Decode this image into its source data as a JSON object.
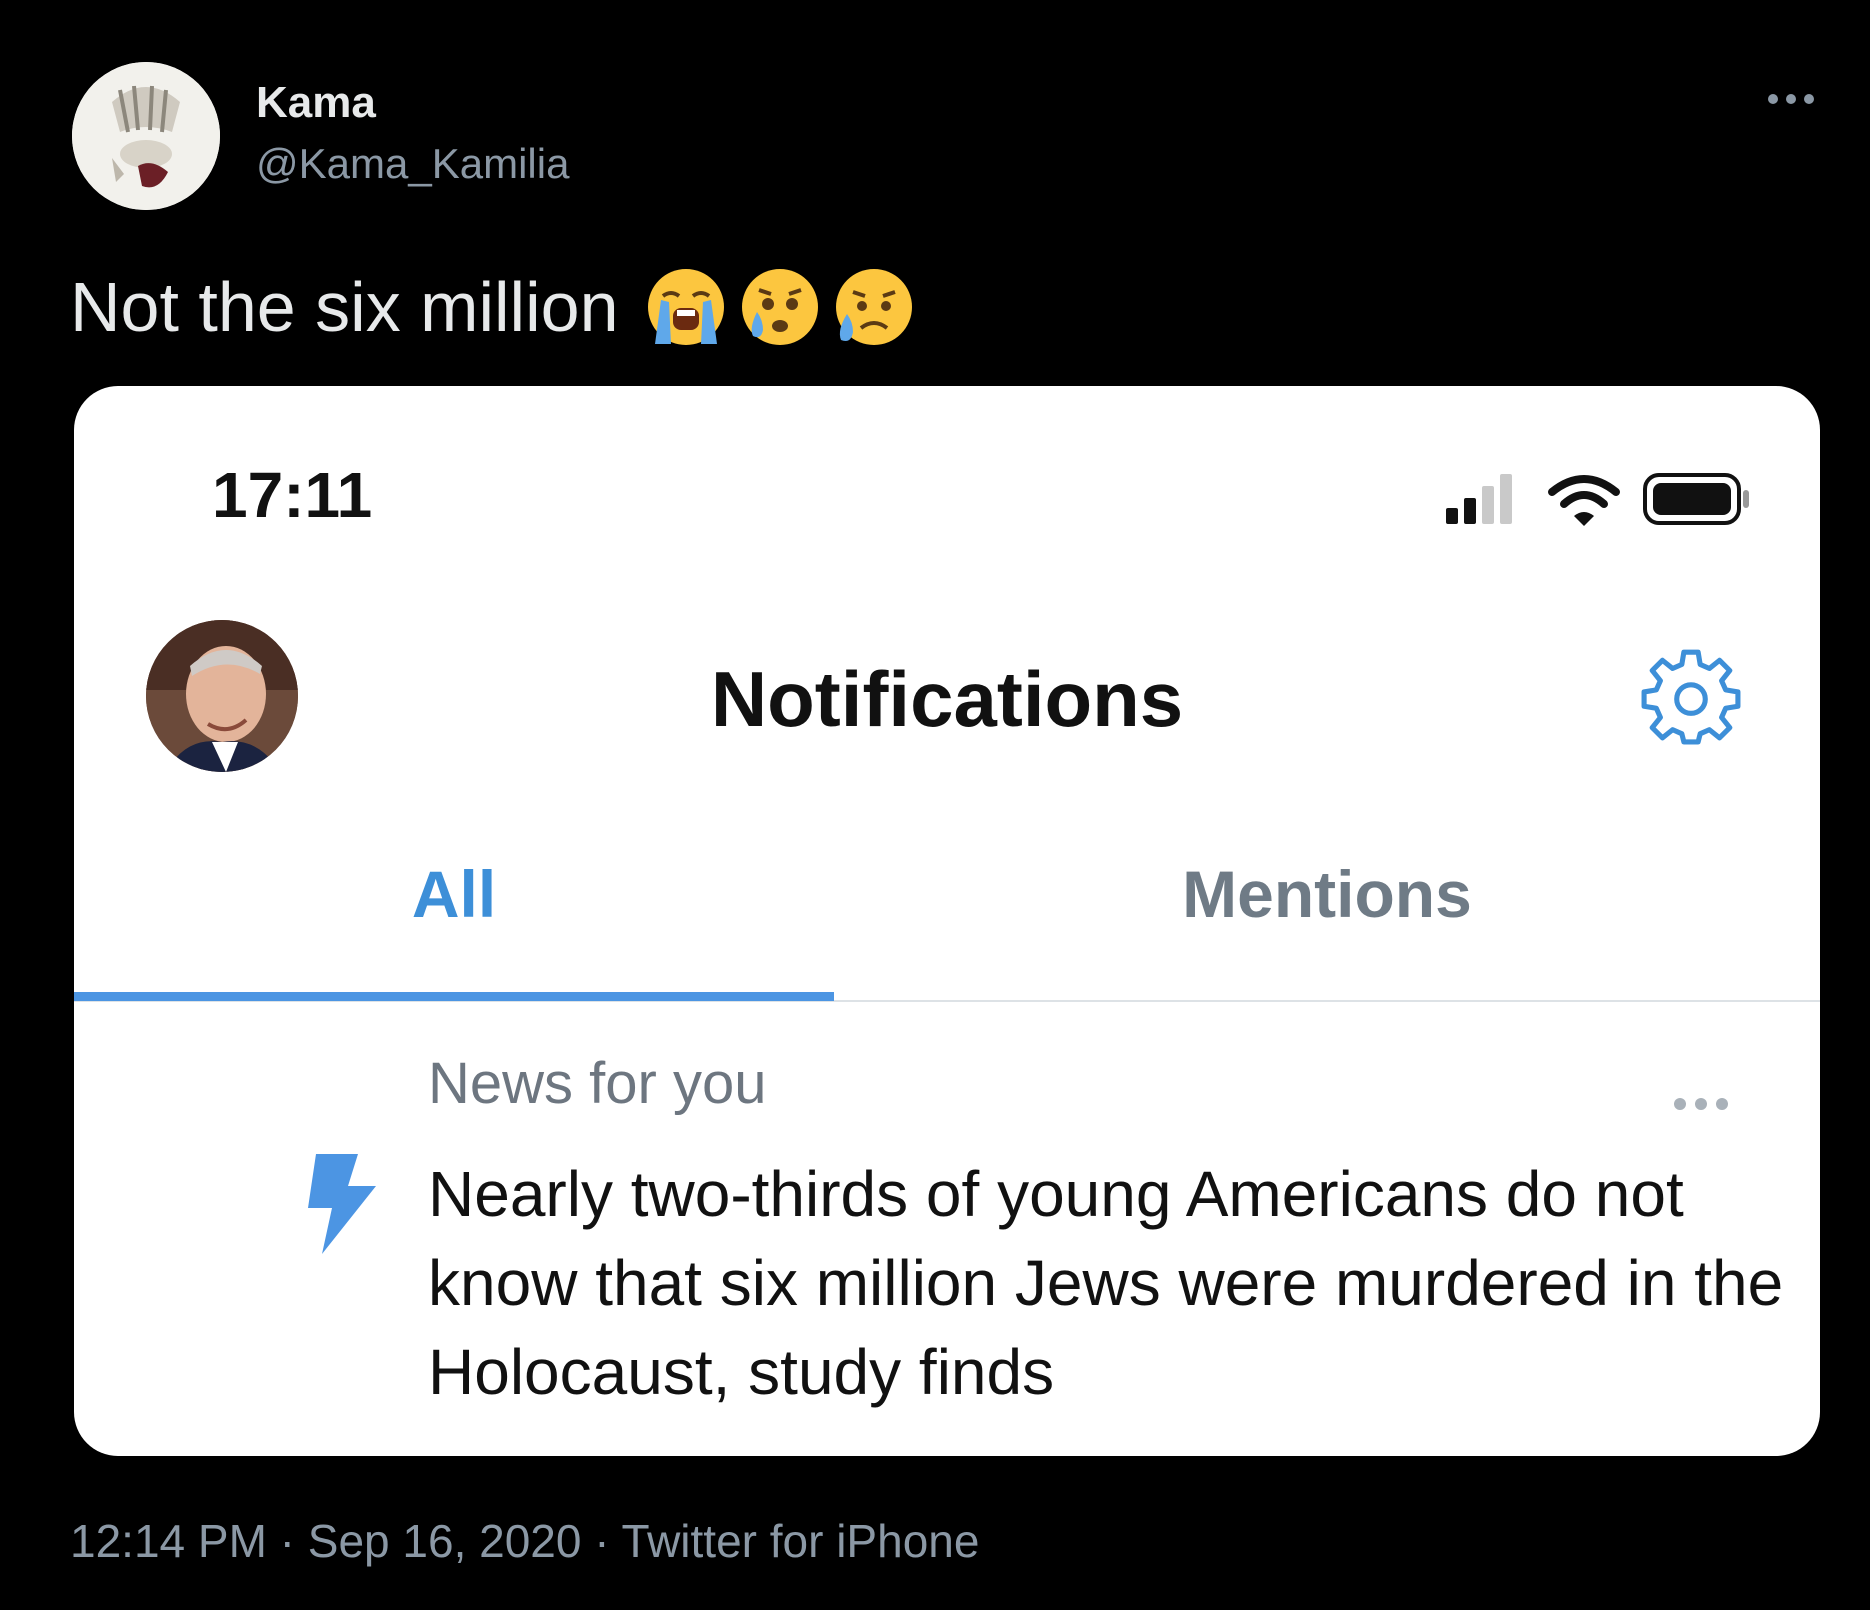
{
  "author": {
    "name": "Kama",
    "handle": "@Kama_Kamilia"
  },
  "tweet": {
    "text": "Not the six million",
    "emojis": [
      "loudly-crying-face-icon",
      "crying-face-icon",
      "sad-but-relieved-face-icon"
    ],
    "meta": "12:14 PM · Sep 16, 2020 · Twitter for iPhone"
  },
  "screenshot": {
    "status_time": "17:11",
    "title": "Notifications",
    "tabs": [
      {
        "label": "All",
        "active": true
      },
      {
        "label": "Mentions",
        "active": false
      }
    ],
    "news": {
      "label": "News for you",
      "headline": "Nearly two-thirds of young Americans do not know that six million Jews were murdered in the Holocaust, study finds"
    }
  },
  "colors": {
    "background": "#000000",
    "accent": "#4c95e3",
    "secondary_text": "#8b98a5"
  }
}
